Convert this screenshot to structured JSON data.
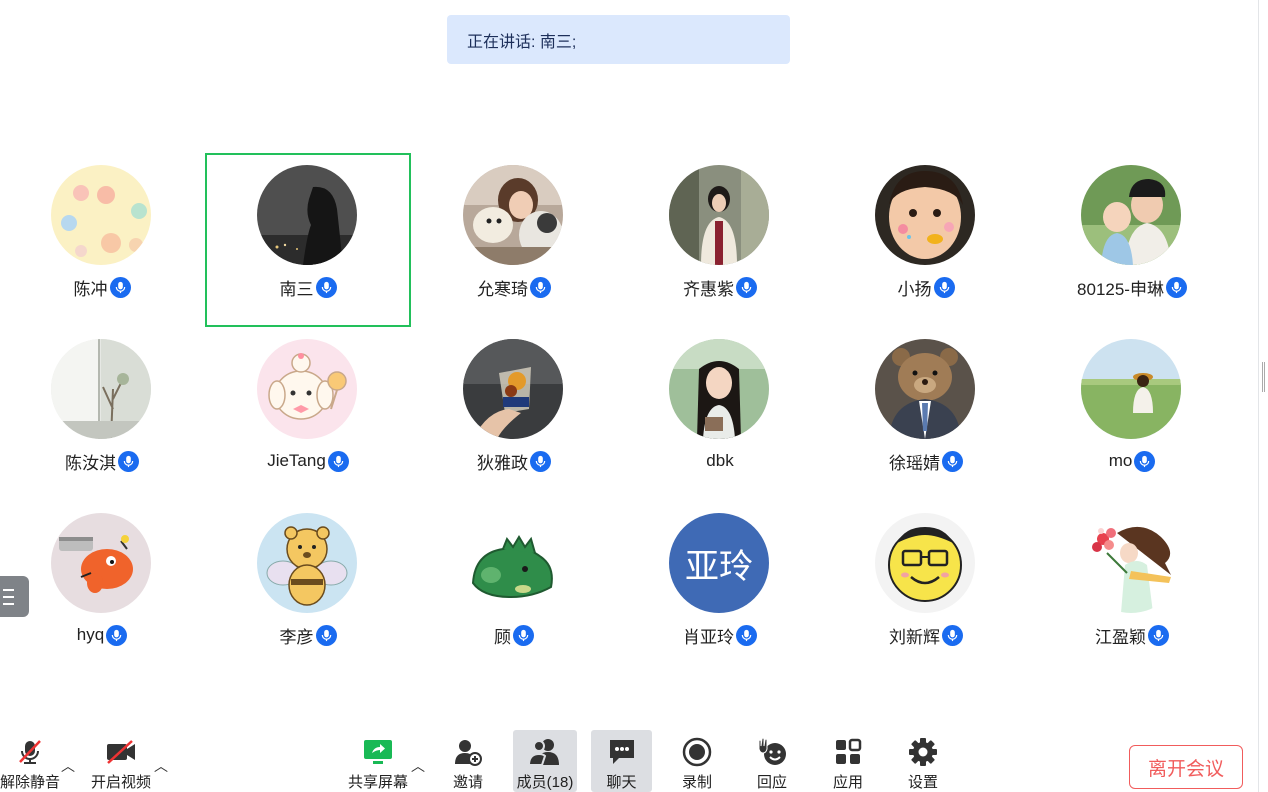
{
  "banner": {
    "text": "正在讲话: 南三;"
  },
  "participants": [
    {
      "name": "陈冲",
      "mic": true,
      "avatar": "pastel-flowers-avatar"
    },
    {
      "name": "南三",
      "mic": true,
      "avatar": "dark-silhouette-avatar",
      "active": true
    },
    {
      "name": "允寒琦",
      "mic": true,
      "avatar": "girl-with-dogs-photo"
    },
    {
      "name": "齐惠紫",
      "mic": true,
      "avatar": "girl-street-photo"
    },
    {
      "name": "小扬",
      "mic": true,
      "avatar": "child-face-photo"
    },
    {
      "name": "80125-申琳",
      "mic": true,
      "avatar": "mother-and-baby-photo"
    },
    {
      "name": "陈汝淇",
      "mic": true,
      "avatar": "window-plant-photo"
    },
    {
      "name": "JieTang",
      "mic": true,
      "avatar": "cartoon-dog-avatar"
    },
    {
      "name": "狄雅政",
      "mic": true,
      "avatar": "drink-cup-photo"
    },
    {
      "name": "dbk",
      "mic": false,
      "avatar": "girl-portrait-photo"
    },
    {
      "name": "徐瑶婧",
      "mic": true,
      "avatar": "teddy-bear-suit-photo"
    },
    {
      "name": "mo",
      "mic": true,
      "avatar": "field-girl-photo"
    },
    {
      "name": "hyq",
      "mic": true,
      "avatar": "chainsaw-dog-cartoon"
    },
    {
      "name": "李彦",
      "mic": true,
      "avatar": "bee-bear-cartoon"
    },
    {
      "name": "顾",
      "mic": true,
      "avatar": "green-dinosaur-cartoon"
    },
    {
      "name": "肖亚玲",
      "mic": true,
      "avatar": "text-avatar",
      "avatar_text": "亚玲",
      "avatar_color": "#3f6ab5"
    },
    {
      "name": "刘新辉",
      "mic": true,
      "avatar": "smiley-glasses-cartoon"
    },
    {
      "name": "江盈颖",
      "mic": true,
      "avatar": "flower-girl-illustration"
    }
  ],
  "toolbar": {
    "unmute": {
      "label": "解除静音",
      "icon": "mic-muted-icon"
    },
    "video": {
      "label": "开启视频",
      "icon": "camera-off-icon"
    },
    "share": {
      "label": "共享屏幕",
      "icon": "share-screen-icon",
      "color": "#19b955"
    },
    "invite": {
      "label": "邀请",
      "icon": "add-user-icon"
    },
    "members": {
      "label": "成员(18)",
      "icon": "members-icon"
    },
    "chat": {
      "label": "聊天",
      "icon": "chat-icon"
    },
    "record": {
      "label": "录制",
      "icon": "record-icon"
    },
    "react": {
      "label": "回应",
      "icon": "reaction-icon"
    },
    "apps": {
      "label": "应用",
      "icon": "apps-icon"
    },
    "settings": {
      "label": "设置",
      "icon": "gear-icon"
    },
    "leave": {
      "label": "离开会议",
      "color": "#f15c5c"
    }
  },
  "colors": {
    "accent": "#1a6bf0",
    "active_border": "#22c05b",
    "banner_bg": "#dbe8fd"
  }
}
